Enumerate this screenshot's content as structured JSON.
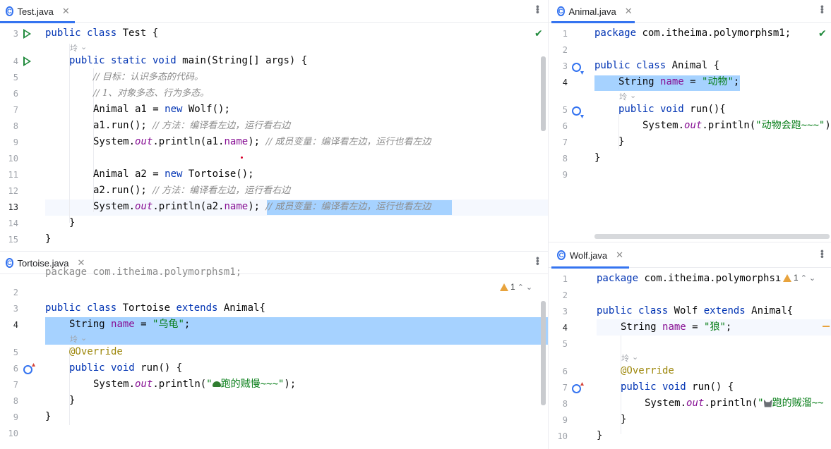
{
  "panes": {
    "test": {
      "tab_label": "Test.java",
      "line_numbers": [
        "3",
        "4",
        "5",
        "6",
        "7",
        "8",
        "9",
        "10",
        "11",
        "12",
        "13",
        "14",
        "15"
      ],
      "hint": "坽",
      "lines": {
        "l3": {
          "a": "public class ",
          "b": "Test {"
        },
        "l4": {
          "a": "public static void ",
          "b": "main(String[] args) {"
        },
        "l5": "// 目标：认识多态的代码。",
        "l6": "// 1、对象多态、行为多态。",
        "l7": {
          "a": "Animal a1 = ",
          "b": "new ",
          "c": "Wolf();"
        },
        "l8": {
          "a": "a1.run(); ",
          "b": "// 方法：编译看左边，运行看右边"
        },
        "l9": {
          "a": "System.",
          "b": "out",
          "c": ".println(a1.",
          "d": "name",
          "e": "); ",
          "f": "// 成员变量：编译看左边，运行也看左边"
        },
        "l11": {
          "a": "Animal a2 = ",
          "b": "new ",
          "c": "Tortoise();"
        },
        "l12": {
          "a": "a2.run(); ",
          "b": "// 方法：编译看左边，运行看右边"
        },
        "l13": {
          "a": "System.",
          "b": "out",
          "c": ".println(a2.",
          "d": "name",
          "e": "); ",
          "f": "// 成员变量：编译看左边，运行也看左边"
        },
        "l14": "}",
        "l15": "}"
      }
    },
    "animal": {
      "tab_label": "Animal.java",
      "line_numbers": [
        "1",
        "2",
        "3",
        "4",
        "5",
        "6",
        "7",
        "8",
        "9"
      ],
      "hint": "坽",
      "lines": {
        "l1": {
          "a": "package ",
          "b": "com.itheima.polymorphsm1;"
        },
        "l3": {
          "a": "public class ",
          "b": "Animal {"
        },
        "l4": {
          "a": "String ",
          "b": "name",
          "c": " = ",
          "d": "\"动物\"",
          "e": ";"
        },
        "l5": {
          "a": "public void ",
          "b": "run(){"
        },
        "l6": {
          "a": "System.",
          "b": "out",
          "c": ".println(",
          "d": "\"动物会跑~~~\"",
          "e": ")"
        },
        "l7": "}",
        "l8": "}"
      }
    },
    "tortoise": {
      "tab_label": "Tortoise.java",
      "line_numbers": [
        "2",
        "3",
        "4",
        "5",
        "6",
        "7",
        "8",
        "9",
        "10"
      ],
      "hint": "坽",
      "warning_count": "1",
      "lines": {
        "l0": "package com.itheima.polymorphsm1;",
        "l3": {
          "a": "public class ",
          "b": "Tortoise ",
          "c": "extends ",
          "d": "Animal{"
        },
        "l4": {
          "a": "String ",
          "b": "name",
          "c": " = ",
          "d": "\"乌龟\"",
          "e": ";"
        },
        "l5": "@Override",
        "l6": {
          "a": "public void ",
          "b": "run() {"
        },
        "l7": {
          "a": "System.",
          "b": "out",
          "c": ".println(",
          "d": "\"",
          "e": "跑的贼慢~~~\"",
          "f": ");"
        },
        "l8": "}",
        "l9": "}"
      }
    },
    "wolf": {
      "tab_label": "Wolf.java",
      "line_numbers": [
        "1",
        "2",
        "3",
        "4",
        "5",
        "6",
        "7",
        "8",
        "9",
        "10"
      ],
      "hint": "坽",
      "warning_count": "1",
      "lines": {
        "l1": {
          "a": "package ",
          "b": "com.itheima.polymorphsı"
        },
        "l3": {
          "a": "public class ",
          "b": "Wolf ",
          "c": "extends ",
          "d": "Animal{"
        },
        "l4": {
          "a": "String ",
          "b": "name",
          "c": " = ",
          "d": "\"狼\"",
          "e": ";"
        },
        "l6": "@Override",
        "l7": {
          "a": "public void ",
          "b": "run() {"
        },
        "l8": {
          "a": "System.",
          "b": "out",
          "c": ".println(",
          "d": "\"",
          "e": "跑的贼溜~~"
        },
        "l9": "}",
        "l10": "}"
      }
    }
  },
  "colors": {
    "keyword": "#0033b3",
    "string": "#067d17",
    "field": "#871094",
    "comment": "#8c8c8c",
    "annotation": "#9e880d",
    "selection": "#a6d2ff",
    "accent": "#3574f0"
  },
  "icons": [
    "run-gutter-icon",
    "class-icon",
    "close-icon",
    "more-icon",
    "overrides-icon",
    "implemented-icon",
    "intention-bulb-icon",
    "inspection-ok-icon",
    "warning-icon",
    "turtle-emoji-icon",
    "wolf-emoji-icon"
  ]
}
